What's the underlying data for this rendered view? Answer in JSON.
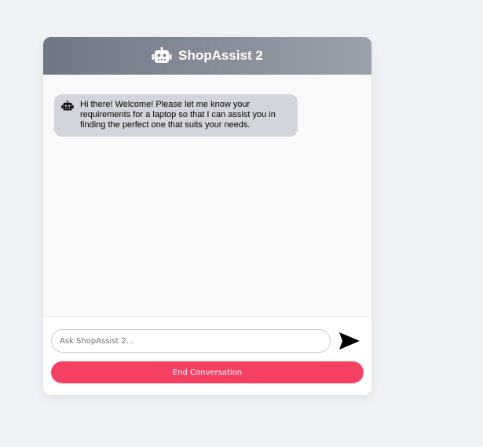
{
  "header": {
    "title": "ShopAssist 2",
    "icon": "robot-icon"
  },
  "messages": [
    {
      "sender": "bot",
      "icon": "robot-icon",
      "text": "Hi there! Welcome! Please let me know your requirements for a laptop so that I can assist you in finding the perfect one that suits your needs."
    }
  ],
  "input": {
    "placeholder": "Ask ShopAssist 2...",
    "value": ""
  },
  "send_button": {
    "icon": "send-arrow-icon"
  },
  "end_button": {
    "label": "End Conversation"
  },
  "colors": {
    "page_background": "#eff2f6",
    "header_gradient_start": "#6f7785",
    "header_gradient_end": "#9ba1ab",
    "bot_bubble": "#d2d6dc",
    "end_button": "#f64063"
  }
}
